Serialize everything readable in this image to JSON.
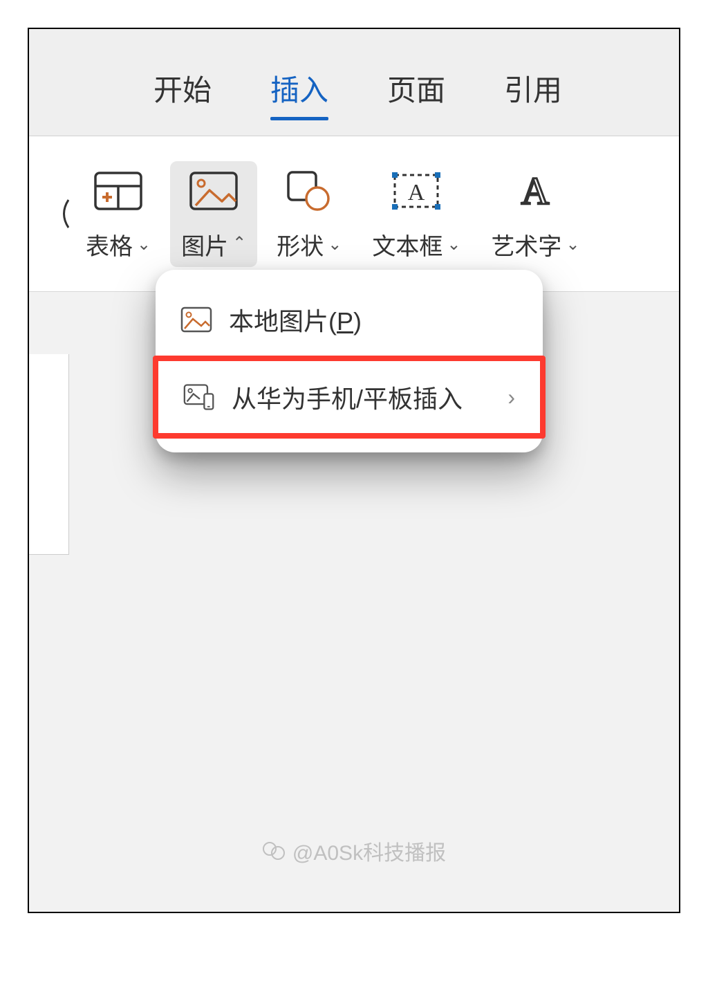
{
  "tabs": {
    "start": "开始",
    "insert": "插入",
    "page": "页面",
    "reference": "引用"
  },
  "ribbon": {
    "table": "表格",
    "picture": "图片",
    "shape": "形状",
    "textbox": "文本框",
    "wordart": "艺术字"
  },
  "dropdown": {
    "local_prefix": "本地图片(",
    "local_key": "P",
    "local_suffix": ")",
    "huawei": "从华为手机/平板插入"
  },
  "watermark": "@A0Sk科技播报"
}
